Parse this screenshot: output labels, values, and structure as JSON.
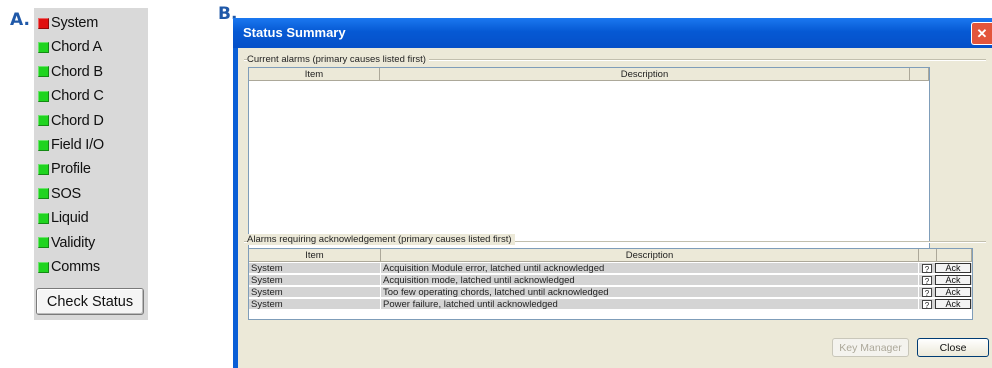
{
  "labels": {
    "a": "A.",
    "b": "B."
  },
  "panel_a": {
    "items": [
      {
        "label": "System",
        "status": "alarm"
      },
      {
        "label": "Chord A",
        "status": "ok"
      },
      {
        "label": "Chord B",
        "status": "ok"
      },
      {
        "label": "Chord C",
        "status": "ok"
      },
      {
        "label": "Chord D",
        "status": "ok"
      },
      {
        "label": "Field I/O",
        "status": "ok"
      },
      {
        "label": "Profile",
        "status": "ok"
      },
      {
        "label": "SOS",
        "status": "ok"
      },
      {
        "label": "Liquid",
        "status": "ok"
      },
      {
        "label": "Validity",
        "status": "ok"
      },
      {
        "label": "Comms",
        "status": "ok"
      }
    ],
    "check_button": "Check Status"
  },
  "colors": {
    "ok": "#1fd41f",
    "alarm": "#e01010",
    "titlebar": "#0a5fd6",
    "close": "#e3553b"
  },
  "dialog": {
    "title": "Status Summary",
    "close_icon": "close-icon",
    "current": {
      "group_label": "Current alarms (primary causes listed first)",
      "columns": [
        "Item",
        "Description"
      ],
      "rows": []
    },
    "ack": {
      "group_label": "Alarms requiring acknowledgement (primary causes listed first)",
      "columns": [
        "Item",
        "Description",
        "",
        ""
      ],
      "rows": [
        {
          "item": "System",
          "description": "Acquisition Module error, latched until acknowledged",
          "help": "?",
          "ack": "Ack"
        },
        {
          "item": "System",
          "description": "Acquisition mode, latched until acknowledged",
          "help": "?",
          "ack": "Ack"
        },
        {
          "item": "System",
          "description": "Too few operating chords, latched until acknowledged",
          "help": "?",
          "ack": "Ack"
        },
        {
          "item": "System",
          "description": "Power failure, latched until acknowledged",
          "help": "?",
          "ack": "Ack"
        }
      ]
    },
    "buttons": {
      "key_manager": "Key Manager",
      "close": "Close"
    }
  }
}
